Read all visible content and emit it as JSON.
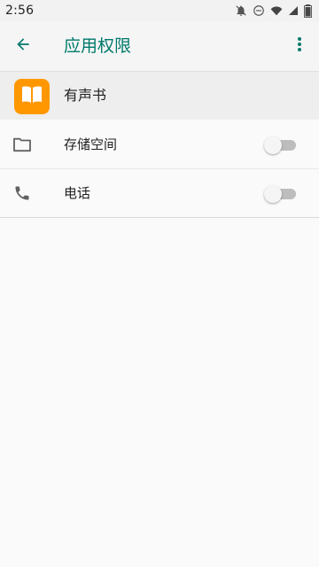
{
  "status_bar": {
    "time": "2:56",
    "icons": [
      "alarm-off-icon",
      "do-not-disturb-icon",
      "wifi-icon",
      "signal-icon",
      "battery-icon"
    ]
  },
  "app_bar": {
    "title": "应用权限",
    "back_icon": "arrow-back-icon",
    "more_icon": "more-vert-icon",
    "accent_color": "#00796b"
  },
  "app": {
    "name": "有声书",
    "icon": "book-icon",
    "icon_color": "#ff9800"
  },
  "permissions": [
    {
      "label": "存储空间",
      "icon": "folder-icon",
      "enabled": false
    },
    {
      "label": "电话",
      "icon": "phone-icon",
      "enabled": false
    }
  ]
}
